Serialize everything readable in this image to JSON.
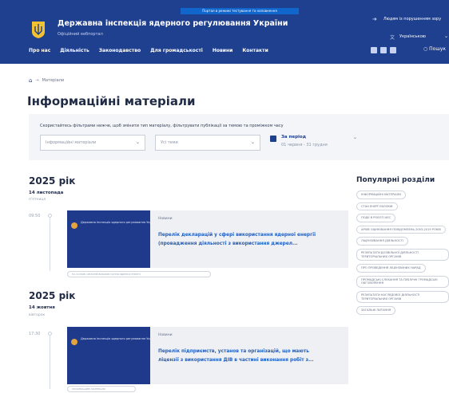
{
  "header": {
    "top_strip": "Портал в режимі тестування та наповнення",
    "title": "Державна інспекція ядерного регулювання України",
    "subtitle": "Офіційний вебпортал",
    "right_link": "Людям із порушенням зору",
    "language": "Українською",
    "nav": [
      "Про нас",
      "Діяльність",
      "Законодавство",
      "Для громадськості",
      "Новини",
      "Контакти"
    ],
    "search_label": "Пошук"
  },
  "breadcrumb": {
    "current": "Матеріали"
  },
  "page_title": "Інформаційні матеріали",
  "filters": {
    "hint": "Скористайтесь фільтрами нижче, щоб змінити тип матеріалу, фільтрувати публікації за темою та проміжком часу",
    "type_placeholder": "Інформаційні матеріали",
    "topic_placeholder": "Усі теми",
    "period_label": "За період",
    "period_dates": "01 червня - 31 грудня"
  },
  "groups": [
    {
      "year": "2025 рік",
      "date": "14 листопада",
      "weekday": "п'ятниця",
      "time": "09:50",
      "thumb_text": "Державна інспекція ядерного регулювання України",
      "tag": "Новини",
      "link_line1": "Перелік декларацій у сфері використання ядерної енергії",
      "link_line2": "(провадження діяльності з використання джерел...",
      "pill": "НА ОСНОВІ ОБ'ЄКТІВ ВИКОРИСТАННЯ ЯДЕРНОЇ ЕНЕРГІЇ"
    },
    {
      "year": "2025 рік",
      "date": "14 жовтня",
      "weekday": "вівторок",
      "time": "17:30",
      "thumb_text": "Державна інспекція ядерного регулювання України",
      "tag": "Новини",
      "link_line1": "Перелік підприємств, установ та організацій, що мають",
      "link_line2": "ліцензії з використання ДІВ в частині виконання робіт з...",
      "pill": "ІНФОРМАЦІЙНІ МАТЕРІАЛИ"
    }
  ],
  "sidebar": {
    "title": "Популярні розділи",
    "items": [
      "Інформаційні матеріали",
      "Стан енергоблоків",
      "Події в роботі АЕС",
      "Архів оцінювання ПОВІДОМЛЕНЬ 2003-2019 років",
      "Ліцензування діяльності",
      "Результати дозвільної діяльності територіальних органів",
      "Про проведення ліцензійних нарад",
      "Промадські слухання та публічні громадські обговорення",
      "Результати наглядової діяльності територіальних органів",
      "Загальні питання"
    ]
  },
  "colors": {
    "header_bg": "#1f3f8f",
    "accent": "#1f5fbf"
  }
}
